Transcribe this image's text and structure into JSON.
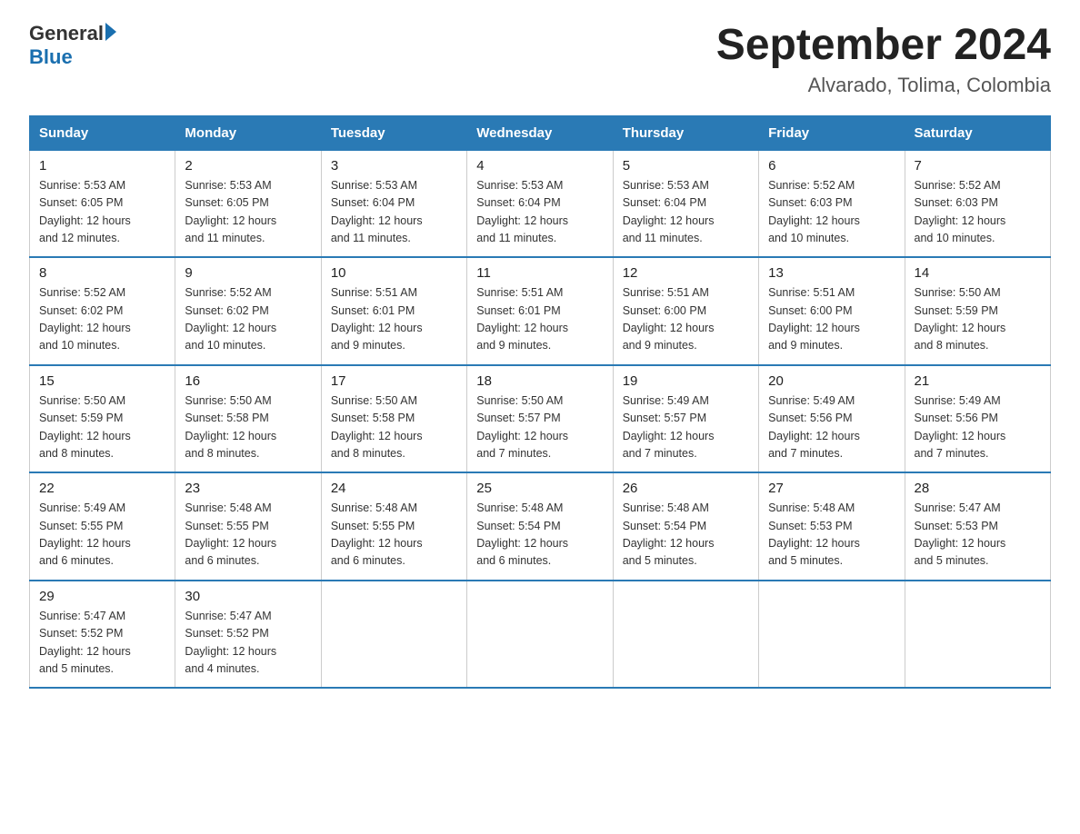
{
  "logo": {
    "general": "General",
    "arrow": "",
    "blue": "Blue"
  },
  "title": "September 2024",
  "subtitle": "Alvarado, Tolima, Colombia",
  "days_of_week": [
    "Sunday",
    "Monday",
    "Tuesday",
    "Wednesday",
    "Thursday",
    "Friday",
    "Saturday"
  ],
  "weeks": [
    [
      {
        "day": "1",
        "sunrise": "5:53 AM",
        "sunset": "6:05 PM",
        "daylight": "12 hours and 12 minutes."
      },
      {
        "day": "2",
        "sunrise": "5:53 AM",
        "sunset": "6:05 PM",
        "daylight": "12 hours and 11 minutes."
      },
      {
        "day": "3",
        "sunrise": "5:53 AM",
        "sunset": "6:04 PM",
        "daylight": "12 hours and 11 minutes."
      },
      {
        "day": "4",
        "sunrise": "5:53 AM",
        "sunset": "6:04 PM",
        "daylight": "12 hours and 11 minutes."
      },
      {
        "day": "5",
        "sunrise": "5:53 AM",
        "sunset": "6:04 PM",
        "daylight": "12 hours and 11 minutes."
      },
      {
        "day": "6",
        "sunrise": "5:52 AM",
        "sunset": "6:03 PM",
        "daylight": "12 hours and 10 minutes."
      },
      {
        "day": "7",
        "sunrise": "5:52 AM",
        "sunset": "6:03 PM",
        "daylight": "12 hours and 10 minutes."
      }
    ],
    [
      {
        "day": "8",
        "sunrise": "5:52 AM",
        "sunset": "6:02 PM",
        "daylight": "12 hours and 10 minutes."
      },
      {
        "day": "9",
        "sunrise": "5:52 AM",
        "sunset": "6:02 PM",
        "daylight": "12 hours and 10 minutes."
      },
      {
        "day": "10",
        "sunrise": "5:51 AM",
        "sunset": "6:01 PM",
        "daylight": "12 hours and 9 minutes."
      },
      {
        "day": "11",
        "sunrise": "5:51 AM",
        "sunset": "6:01 PM",
        "daylight": "12 hours and 9 minutes."
      },
      {
        "day": "12",
        "sunrise": "5:51 AM",
        "sunset": "6:00 PM",
        "daylight": "12 hours and 9 minutes."
      },
      {
        "day": "13",
        "sunrise": "5:51 AM",
        "sunset": "6:00 PM",
        "daylight": "12 hours and 9 minutes."
      },
      {
        "day": "14",
        "sunrise": "5:50 AM",
        "sunset": "5:59 PM",
        "daylight": "12 hours and 8 minutes."
      }
    ],
    [
      {
        "day": "15",
        "sunrise": "5:50 AM",
        "sunset": "5:59 PM",
        "daylight": "12 hours and 8 minutes."
      },
      {
        "day": "16",
        "sunrise": "5:50 AM",
        "sunset": "5:58 PM",
        "daylight": "12 hours and 8 minutes."
      },
      {
        "day": "17",
        "sunrise": "5:50 AM",
        "sunset": "5:58 PM",
        "daylight": "12 hours and 8 minutes."
      },
      {
        "day": "18",
        "sunrise": "5:50 AM",
        "sunset": "5:57 PM",
        "daylight": "12 hours and 7 minutes."
      },
      {
        "day": "19",
        "sunrise": "5:49 AM",
        "sunset": "5:57 PM",
        "daylight": "12 hours and 7 minutes."
      },
      {
        "day": "20",
        "sunrise": "5:49 AM",
        "sunset": "5:56 PM",
        "daylight": "12 hours and 7 minutes."
      },
      {
        "day": "21",
        "sunrise": "5:49 AM",
        "sunset": "5:56 PM",
        "daylight": "12 hours and 7 minutes."
      }
    ],
    [
      {
        "day": "22",
        "sunrise": "5:49 AM",
        "sunset": "5:55 PM",
        "daylight": "12 hours and 6 minutes."
      },
      {
        "day": "23",
        "sunrise": "5:48 AM",
        "sunset": "5:55 PM",
        "daylight": "12 hours and 6 minutes."
      },
      {
        "day": "24",
        "sunrise": "5:48 AM",
        "sunset": "5:55 PM",
        "daylight": "12 hours and 6 minutes."
      },
      {
        "day": "25",
        "sunrise": "5:48 AM",
        "sunset": "5:54 PM",
        "daylight": "12 hours and 6 minutes."
      },
      {
        "day": "26",
        "sunrise": "5:48 AM",
        "sunset": "5:54 PM",
        "daylight": "12 hours and 5 minutes."
      },
      {
        "day": "27",
        "sunrise": "5:48 AM",
        "sunset": "5:53 PM",
        "daylight": "12 hours and 5 minutes."
      },
      {
        "day": "28",
        "sunrise": "5:47 AM",
        "sunset": "5:53 PM",
        "daylight": "12 hours and 5 minutes."
      }
    ],
    [
      {
        "day": "29",
        "sunrise": "5:47 AM",
        "sunset": "5:52 PM",
        "daylight": "12 hours and 5 minutes."
      },
      {
        "day": "30",
        "sunrise": "5:47 AM",
        "sunset": "5:52 PM",
        "daylight": "12 hours and 4 minutes."
      },
      null,
      null,
      null,
      null,
      null
    ]
  ]
}
